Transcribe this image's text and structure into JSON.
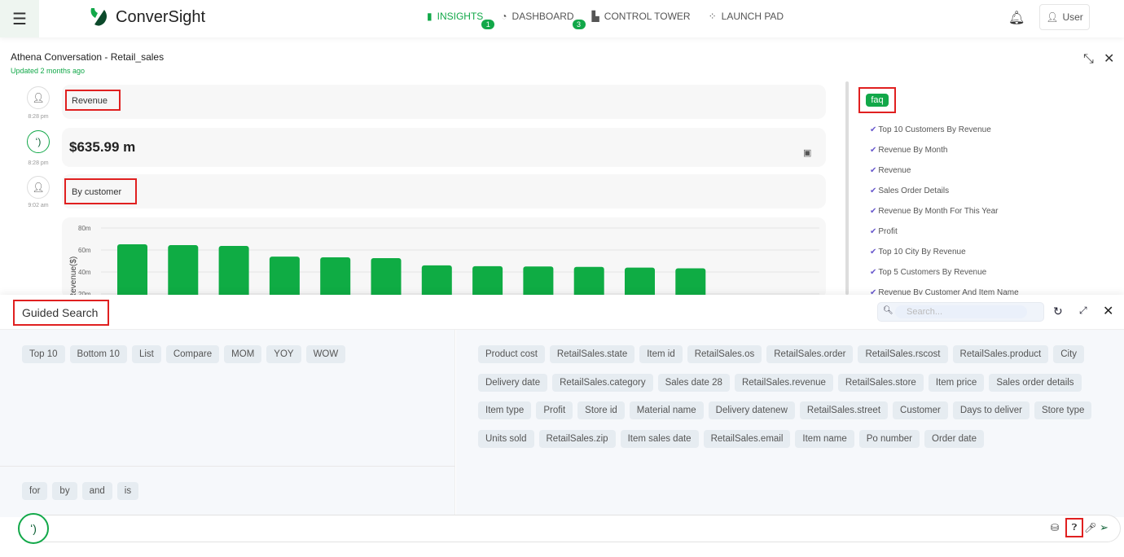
{
  "header": {
    "logo": "ConverSight",
    "nav": [
      {
        "label": "INSIGHTS",
        "badge": "1"
      },
      {
        "label": "DASHBOARD",
        "badge": "3"
      },
      {
        "label": "CONTROL TOWER"
      },
      {
        "label": "LAUNCH PAD"
      }
    ],
    "user": "User"
  },
  "page": {
    "title": "Athena Conversation - Retail_sales",
    "updated": "Updated 2 months ago"
  },
  "conversation": [
    {
      "text": "Revenue",
      "time": "8:28 pm"
    },
    {
      "text": "$635.99 m",
      "time": "8:28 pm"
    },
    {
      "text": "By customer",
      "time": "9:02 am"
    }
  ],
  "chart_data": {
    "type": "bar",
    "ylabel": "Revenue($)",
    "ylim": [
      0,
      80
    ],
    "yticks": [
      "80m",
      "60m",
      "40m",
      "20m"
    ],
    "values": [
      65.2,
      64.4,
      63.7,
      54,
      53.3,
      52.6,
      46,
      45.3,
      45,
      44.6,
      44,
      43.3
    ],
    "color": "#0fac44",
    "grid": true
  },
  "faq": {
    "label": "faq",
    "items": [
      "Top 10 Customers By Revenue",
      "Revenue By Month",
      "Revenue",
      "Sales Order Details",
      "Revenue By Month For This Year",
      "Profit",
      "Top 10 City By Revenue",
      "Top 5 Customers By Revenue",
      "Revenue By Customer And Item Name"
    ]
  },
  "guided": {
    "title": "Guided Search",
    "search_placeholder": "Search...",
    "operators": [
      "Top 10",
      "Bottom 10",
      "List",
      "Compare",
      "MOM",
      "YOY",
      "WOW"
    ],
    "connectors": [
      "for",
      "by",
      "and",
      "is"
    ],
    "fields": [
      "Product cost",
      "RetailSales.state",
      "Item id",
      "RetailSales.os",
      "RetailSales.order",
      "RetailSales.rscost",
      "RetailSales.product",
      "City",
      "Delivery date",
      "RetailSales.category",
      "Sales date 28",
      "RetailSales.revenue",
      "RetailSales.store",
      "Item price",
      "Sales order details",
      "Item type",
      "Profit",
      "Store id",
      "Material name",
      "Delivery datenew",
      "RetailSales.street",
      "Customer",
      "Days to deliver",
      "Store type",
      "Units sold",
      "RetailSales.zip",
      "Item sales date",
      "RetailSales.email",
      "Item name",
      "Po number",
      "Order date"
    ]
  },
  "accent": "#12a849"
}
